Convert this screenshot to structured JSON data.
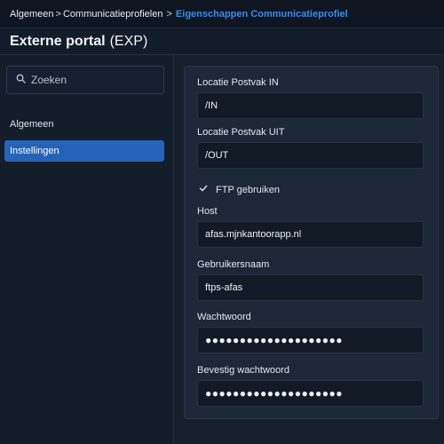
{
  "breadcrumb": {
    "items": [
      "Algemeen",
      "Communicatieprofielen"
    ],
    "separator": ">",
    "current": "Eigenschappen Communicatieprofiel"
  },
  "header": {
    "title": "Externe portal",
    "code": "(EXP)"
  },
  "sidebar": {
    "search_placeholder": "Zoeken",
    "items": [
      {
        "label": "Algemeen",
        "active": false
      },
      {
        "label": "Instellingen",
        "active": true
      }
    ]
  },
  "form": {
    "inbox_label": "Locatie Postvak IN",
    "inbox_value": "/IN",
    "outbox_label": "Locatie Postvak UIT",
    "outbox_value": "/OUT",
    "ftp_label": "FTP gebruiken",
    "ftp_checked": true,
    "host_label": "Host",
    "host_value": "afas.mjnkantoorapp.nl",
    "username_label": "Gebruikersnaam",
    "username_value": "ftps-afas",
    "password_label": "Wachtwoord",
    "password_value": "●●●●●●●●●●●●●●●●●●●●",
    "confirm_label": "Bevestig wachtwoord",
    "confirm_value": "●●●●●●●●●●●●●●●●●●●●"
  },
  "colors": {
    "accent": "#2563b8",
    "breadcrumb_current": "#3d8bea",
    "background": "#121a26"
  },
  "icons": {
    "search": "search-icon",
    "check": "check-icon"
  }
}
